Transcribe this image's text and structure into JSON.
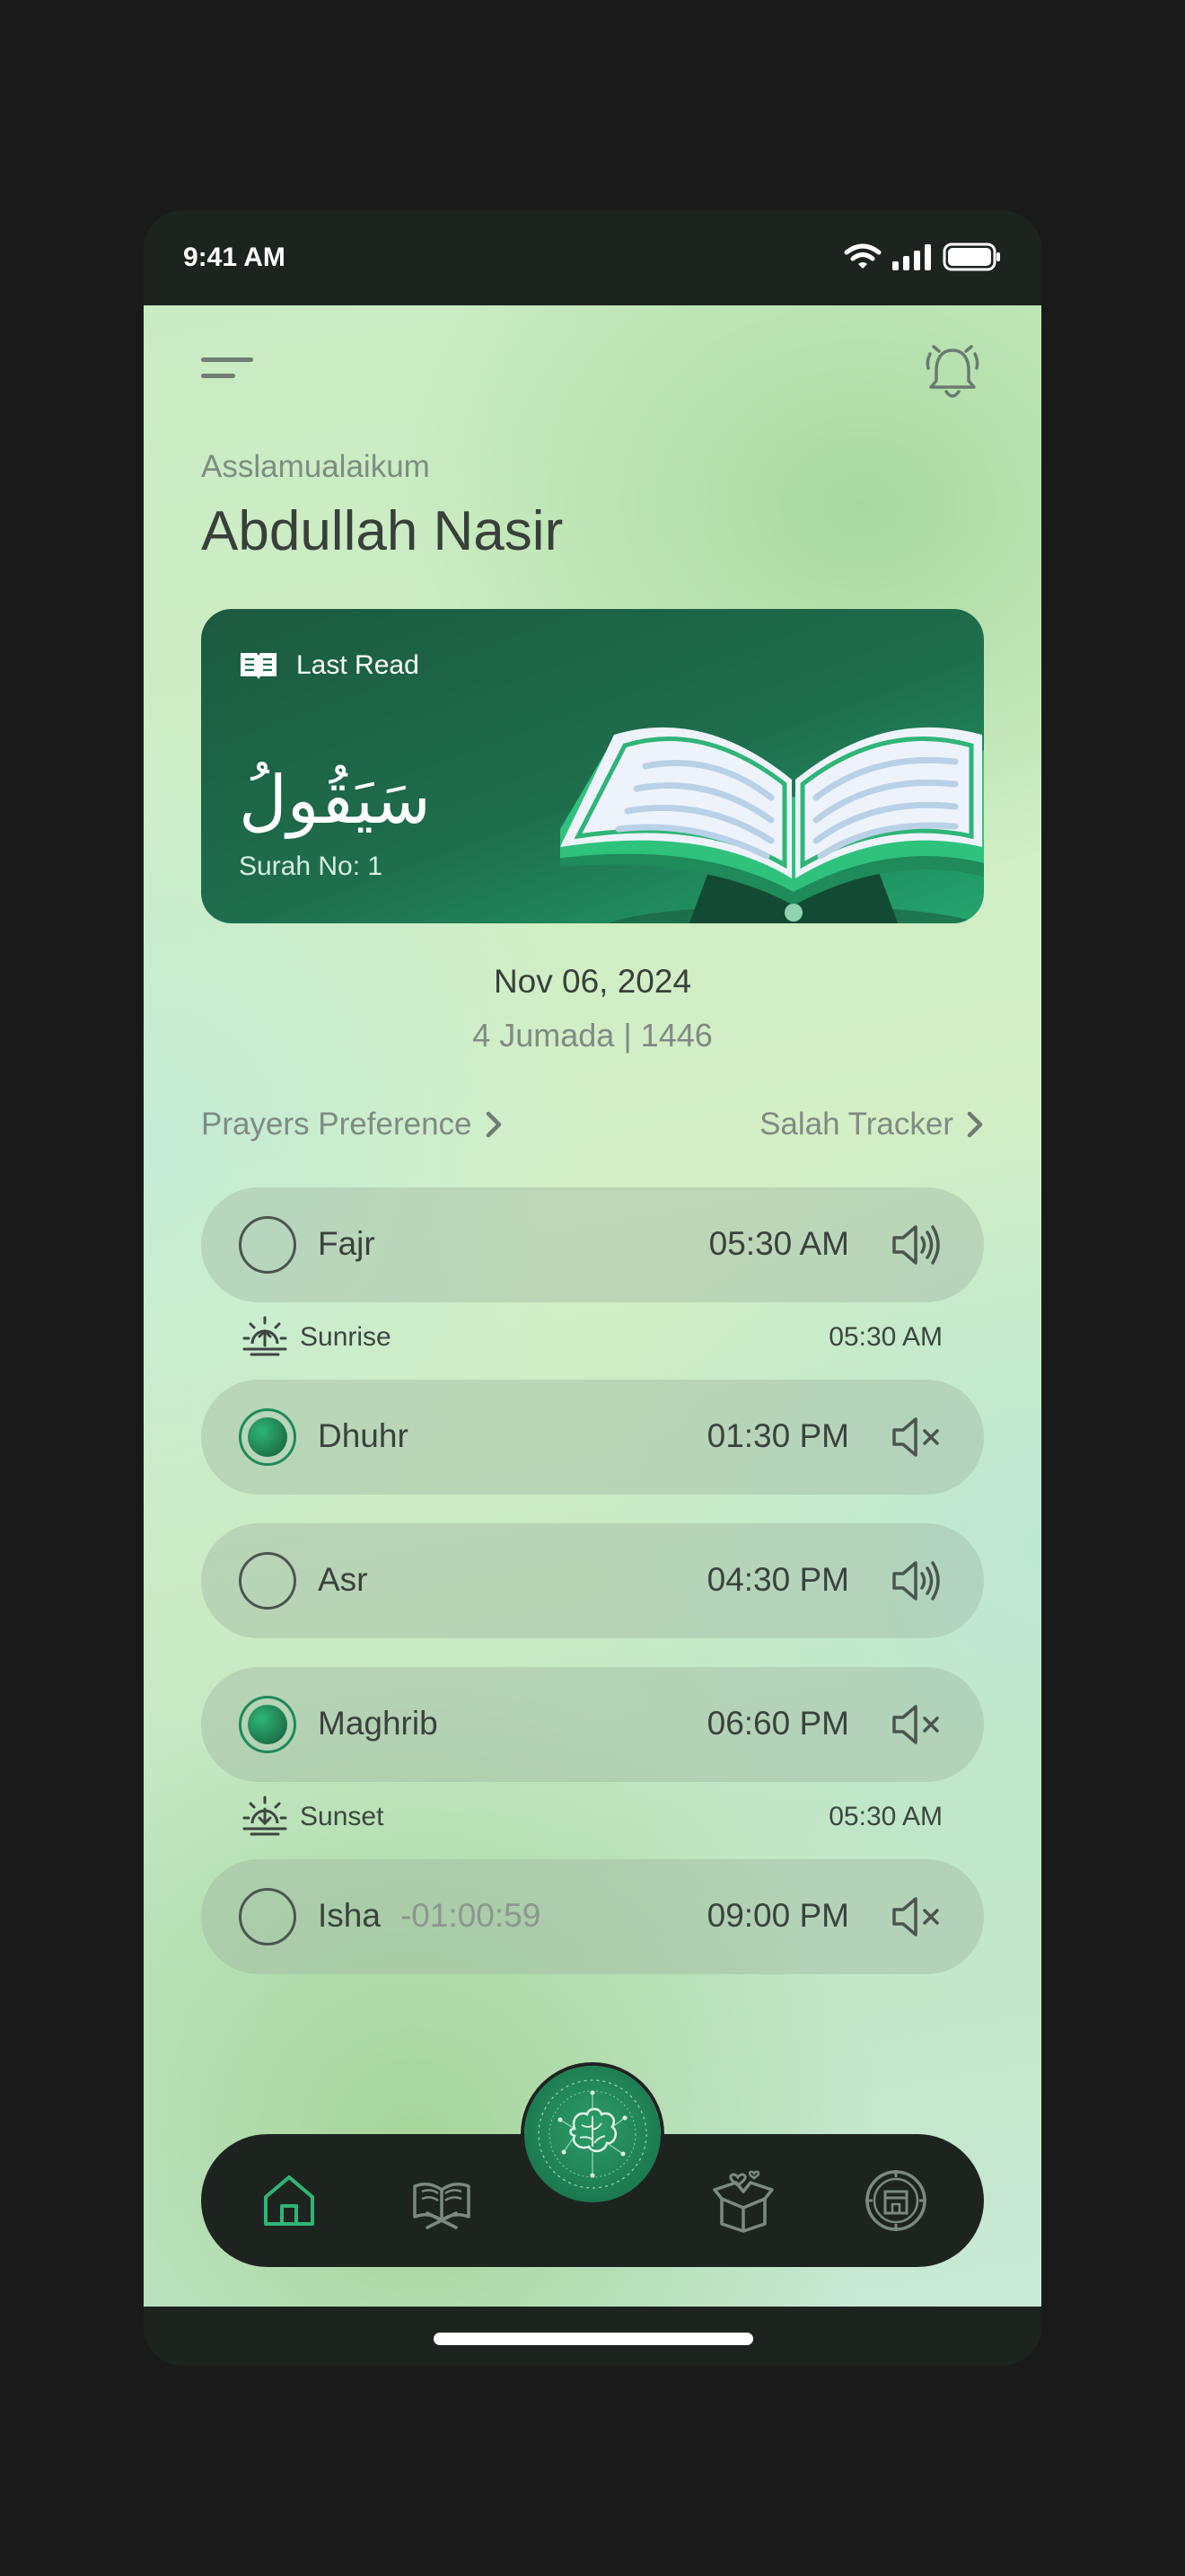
{
  "status_bar": {
    "time": "9:41 AM"
  },
  "header": {
    "greeting": "Asslamualaikum",
    "user_name": "Abdullah Nasir"
  },
  "last_read": {
    "label": "Last Read",
    "arabic_title": "سَيَقُولُ",
    "surah": "Surah No: 1"
  },
  "dates": {
    "gregorian": "Nov 06, 2024",
    "hijri": "4 Jumada | 1446"
  },
  "links": {
    "prayers_preference": "Prayers Preference",
    "salah_tracker": "Salah Tracker"
  },
  "prayers": [
    {
      "name": "Fajr",
      "time": "05:30 AM",
      "checked": false,
      "sound": "speaker-on-icon",
      "countdown": ""
    },
    {
      "name": "Dhuhr",
      "time": "01:30 PM",
      "checked": true,
      "sound": "speaker-muted-icon",
      "countdown": ""
    },
    {
      "name": "Asr",
      "time": "04:30 PM",
      "checked": false,
      "sound": "speaker-on-icon",
      "countdown": ""
    },
    {
      "name": "Maghrib",
      "time": "06:60 PM",
      "checked": true,
      "sound": "speaker-muted-icon",
      "countdown": ""
    },
    {
      "name": "Isha",
      "time": "09:00 PM",
      "checked": false,
      "sound": "speaker-muted-icon",
      "countdown": "-01:00:59"
    }
  ],
  "sun_events": [
    {
      "label": "Sunrise",
      "time": "05:30 AM",
      "icon": "sunrise-icon"
    },
    {
      "label": "Sunset",
      "time": "05:30 AM",
      "icon": "sunset-icon"
    }
  ],
  "bottom_nav": {
    "items": [
      "home-icon",
      "quran-book-icon",
      "ai-brain-icon",
      "gift-box-icon",
      "kaaba-compass-icon"
    ],
    "active": "home-icon"
  },
  "colors": {
    "accent": "#1e7a52",
    "dark": "#1d2420",
    "text": "#38403b",
    "muted": "#808a84"
  }
}
